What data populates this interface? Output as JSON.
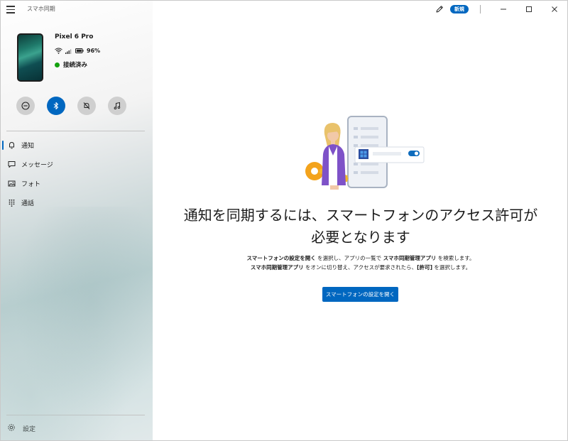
{
  "app": {
    "title": "スマホ同期"
  },
  "titlebar": {
    "new_badge": "新規"
  },
  "device": {
    "name": "Pixel 6 Pro",
    "battery": "96%",
    "status": "接続済み",
    "status_color": "#13a10e"
  },
  "quick_actions": [
    {
      "name": "do-not-disturb",
      "icon": "minus-circle-icon",
      "active": false
    },
    {
      "name": "bluetooth",
      "icon": "bluetooth-icon",
      "active": true
    },
    {
      "name": "mute",
      "icon": "bell-off-icon",
      "active": false
    },
    {
      "name": "audio",
      "icon": "music-note-icon",
      "active": false
    }
  ],
  "nav": {
    "items": [
      {
        "label": "通知",
        "icon": "bell-icon",
        "selected": true
      },
      {
        "label": "メッセージ",
        "icon": "chat-icon",
        "selected": false
      },
      {
        "label": "フォト",
        "icon": "image-icon",
        "selected": false
      },
      {
        "label": "通話",
        "icon": "dialpad-icon",
        "selected": false
      }
    ],
    "settings_label": "設定"
  },
  "main": {
    "headline_line1": "通知を同期するには、スマートフォンのアクセス許可が",
    "headline_line2": "必要となります",
    "instr1": {
      "b1": "スマートフォンの設定を開く",
      "t1": " を選択し、アプリの一覧で ",
      "b2": "スマホ同期管理アプリ",
      "t2": " を検索します。"
    },
    "instr2": {
      "b1": "スマホ同期管理アプリ",
      "t1": " をオンに切り替え、アクセスが要求されたら、",
      "b2": "[許可]",
      "t2": " を選択します。"
    },
    "button": "スマートフォンの設定を開く"
  },
  "colors": {
    "accent": "#0067c0"
  }
}
